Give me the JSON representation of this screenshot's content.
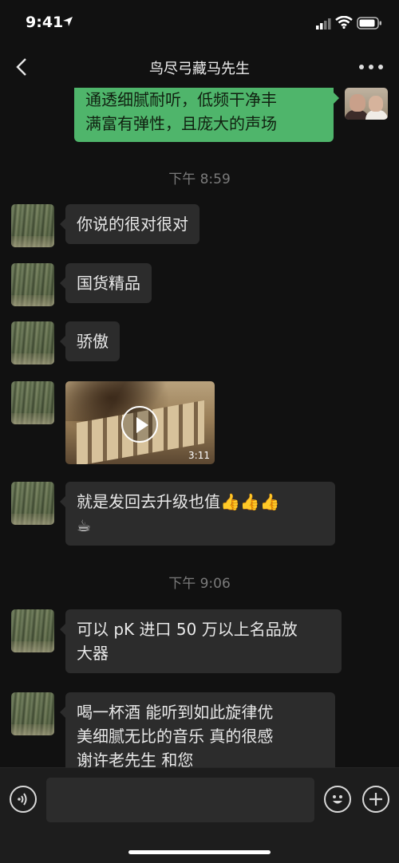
{
  "status_bar": {
    "time": "9:41"
  },
  "nav": {
    "title": "鸟尽弓藏马先生",
    "back_icon": "chevron-left-icon",
    "more_icon": "more-dots-icon"
  },
  "colors": {
    "background": "#111111",
    "bubble_other": "#2c2c2c",
    "bubble_self": "#4fb56b",
    "timestamp": "#7a7a7a"
  },
  "messages": {
    "self_top": {
      "lines": [
        "通透细腻耐听，低频干净丰",
        "满富有弹性，且庞大的声场"
      ]
    },
    "time1": "下午 8:59",
    "m1": "你说的很对很对",
    "m2": "国货精品",
    "m3": "骄傲",
    "video": {
      "duration": "3:11",
      "icon": "play-icon"
    },
    "m4": {
      "line1": "就是发回去升级也值👍👍👍",
      "line2": "☕"
    },
    "time2": "下午 9:06",
    "m5": {
      "line1": "可以 pK 进口 50 万以上名品放",
      "line2": "大器"
    },
    "m6": {
      "line1": "喝一杯酒  能听到如此旋律优",
      "line2": "美细腻无比的音乐  真的很感",
      "line3": "谢许老先生  和您"
    }
  },
  "input_bar": {
    "placeholder": "",
    "voice_icon": "voice-icon",
    "emoji_icon": "emoji-icon",
    "plus_icon": "plus-icon"
  }
}
